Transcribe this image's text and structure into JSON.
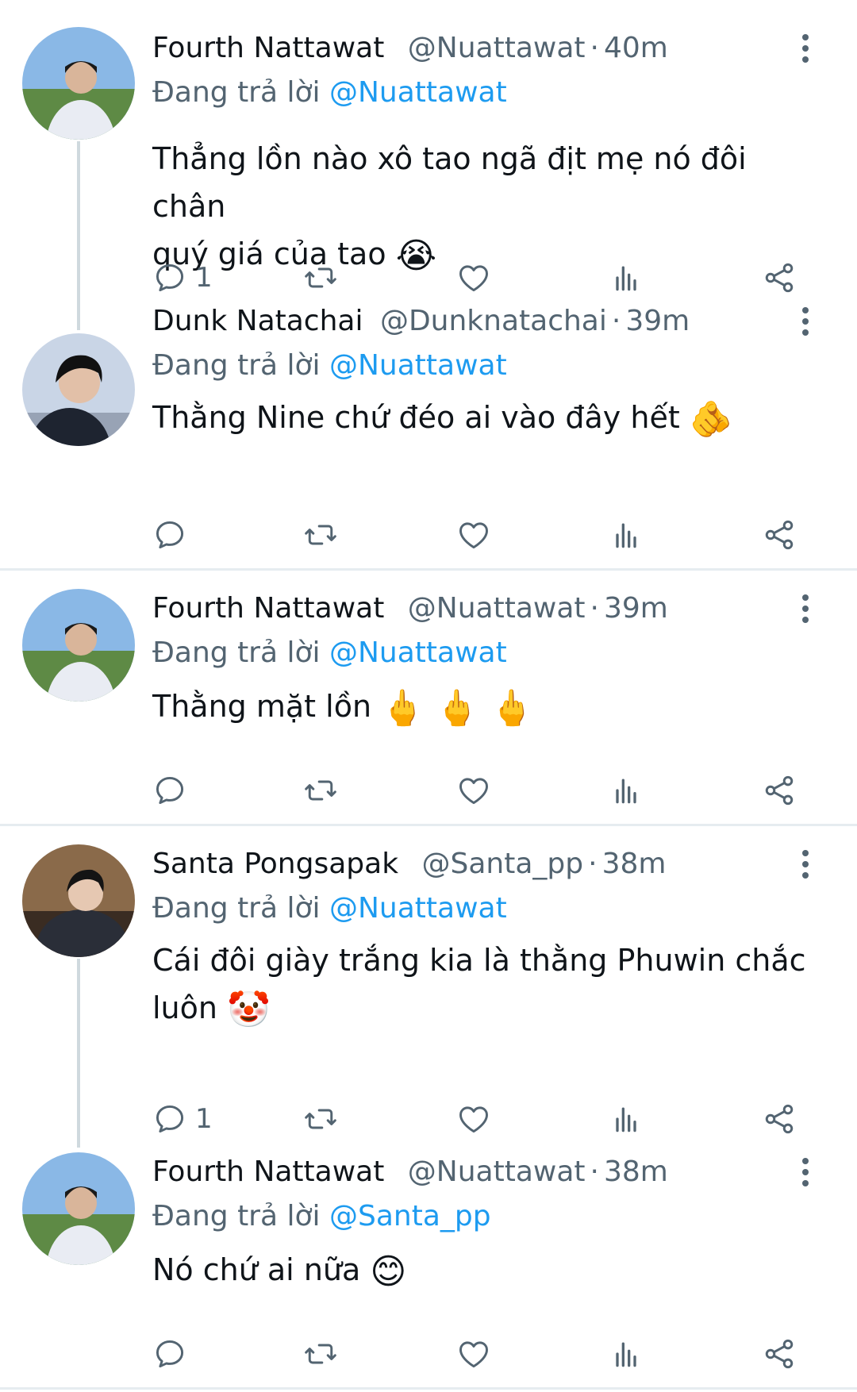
{
  "reply_prefix": "Đang trả lời",
  "tweets": [
    {
      "name": "Fourth Nattawat",
      "handle": "@Nuattawat",
      "time": "40m",
      "reply_to": "@Nuattawat",
      "text_lines": [
        "Thẳng lồn nào xô tao ngã địt mẹ nó đôi chân",
        "quý giá của tao"
      ],
      "emoji": "😭",
      "reply_count": "1",
      "avatar_colors": {
        "sky": "#8ab8e6",
        "ground": "#5e8a45",
        "shirt": "#e9ecf3",
        "hair": "#1a1a1a"
      }
    },
    {
      "name": "Dunk Natachai",
      "handle": "@Dunknatachai",
      "time": "39m",
      "reply_to": "@Nuattawat",
      "text_lines": [
        "Thằng Nine chứ đéo ai vào đây hết"
      ],
      "emoji": "🫵",
      "reply_count": "",
      "avatar_colors": {
        "sky": "#c9d5e6",
        "ground": "#98a3b5",
        "shirt": "#1e2430",
        "hair": "#111111"
      }
    },
    {
      "name": "Fourth Nattawat",
      "handle": "@Nuattawat",
      "time": "39m",
      "reply_to": "@Nuattawat",
      "text_lines": [
        "Thằng mặt lồn"
      ],
      "emoji": "🖕 🖕 🖕",
      "reply_count": "",
      "avatar_colors": {
        "sky": "#8ab8e6",
        "ground": "#5e8a45",
        "shirt": "#e9ecf3",
        "hair": "#1a1a1a"
      }
    },
    {
      "name": "Santa Pongsapak",
      "handle": "@Santa_pp",
      "time": "38m",
      "reply_to": "@Nuattawat",
      "text_lines": [
        "Cái đôi giày trắng kia là thằng Phuwin chắc",
        "luôn"
      ],
      "emoji": "🤡",
      "reply_count": "1",
      "avatar_colors": {
        "sky": "#8a6a4a",
        "ground": "#3a2c22",
        "shirt": "#2a2e38",
        "hair": "#141414"
      }
    },
    {
      "name": "Fourth Nattawat",
      "handle": "@Nuattawat",
      "time": "38m",
      "reply_to": "@Santa_pp",
      "text_lines": [
        "Nó chứ ai nữa"
      ],
      "emoji": "😊",
      "reply_count": "",
      "avatar_colors": {
        "sky": "#8ab8e6",
        "ground": "#5e8a45",
        "shirt": "#e9ecf3",
        "hair": "#1a1a1a"
      }
    }
  ],
  "icons": {
    "reply": "reply-icon",
    "retweet": "retweet-icon",
    "like": "heart-icon",
    "views": "views-icon",
    "share": "share-icon",
    "more": "more-vertical-icon"
  },
  "colors": {
    "accent": "#1d9bf0",
    "secondary_text": "#536471",
    "divider": "#e6ecf0",
    "thread_line": "#cfd9de"
  }
}
